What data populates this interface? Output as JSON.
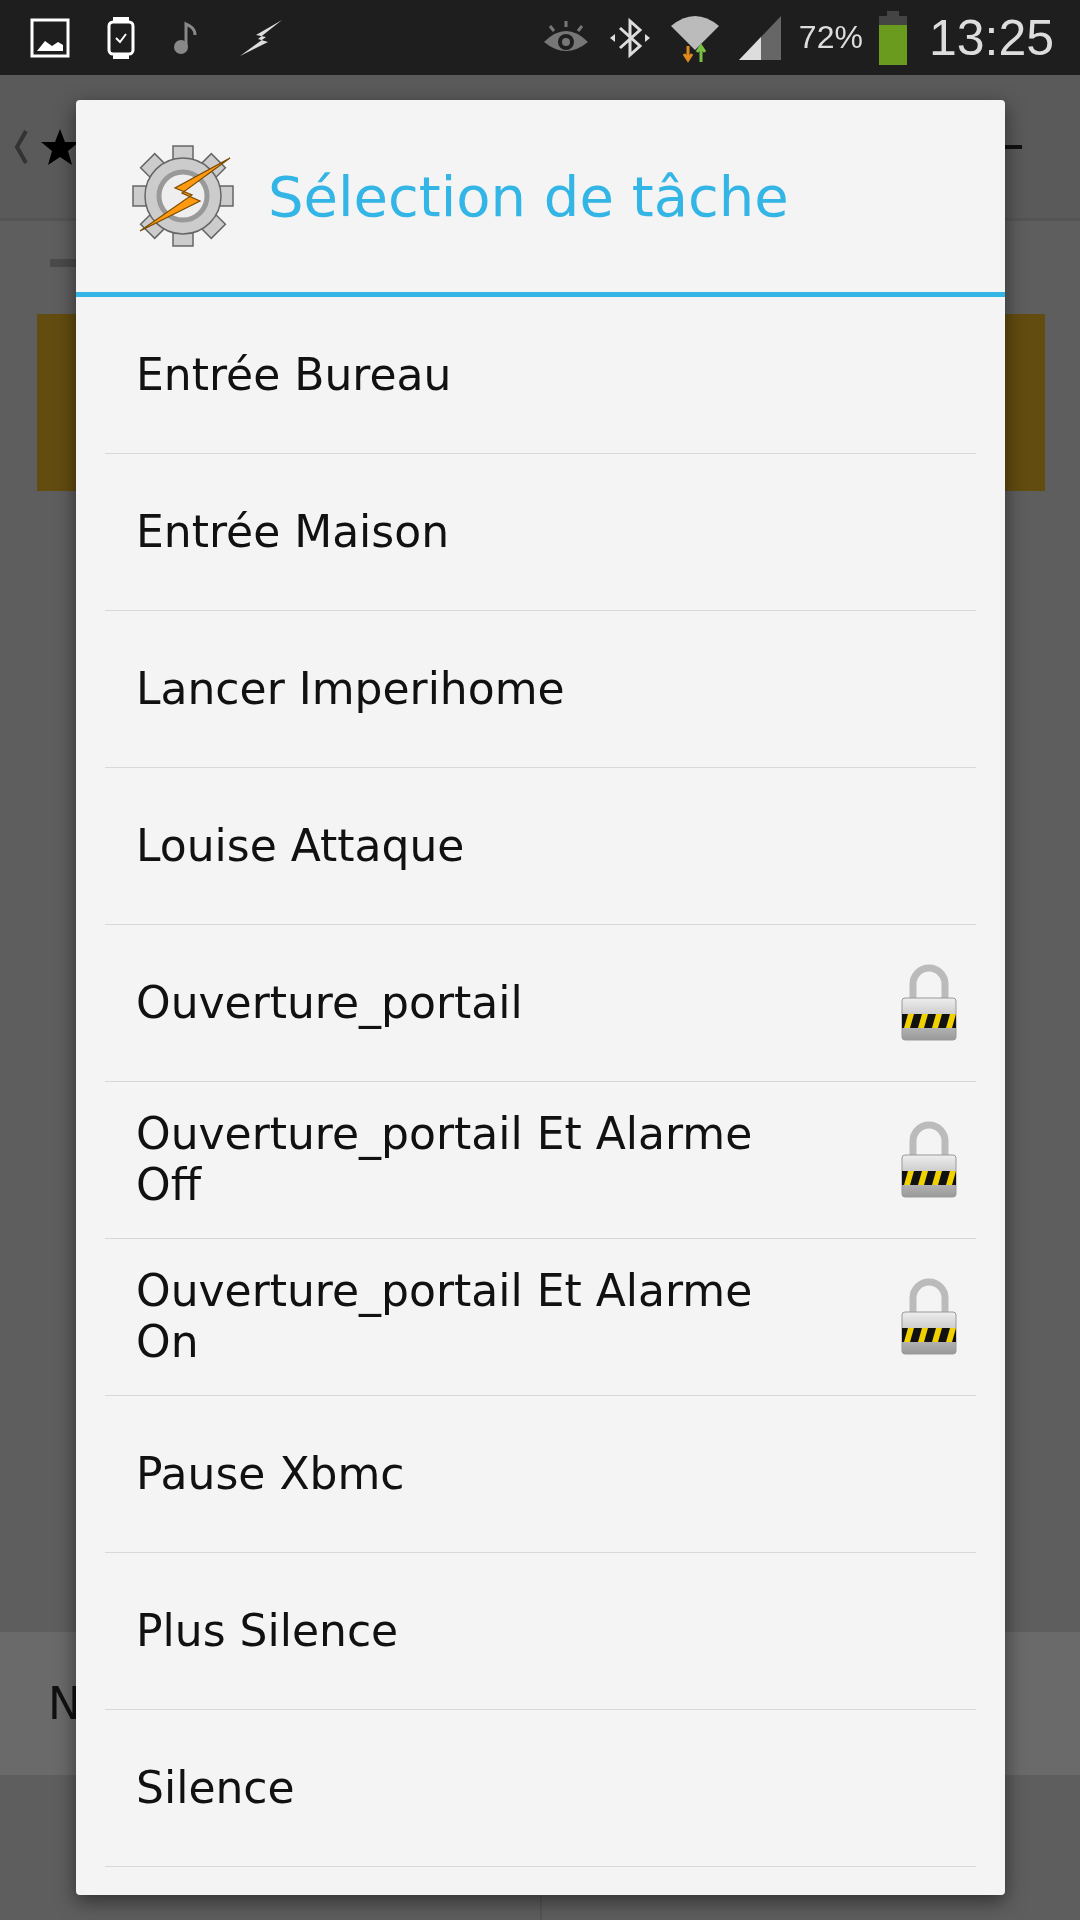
{
  "status_bar": {
    "battery": "72%",
    "time": "13:25"
  },
  "background": {
    "bottom_bar_text": "N"
  },
  "dialog": {
    "title": "Sélection de tâche",
    "items": [
      {
        "label": "Entrée Bureau",
        "locked": false
      },
      {
        "label": "Entrée Maison",
        "locked": false
      },
      {
        "label": "Lancer Imperihome",
        "locked": false
      },
      {
        "label": "Louise Attaque",
        "locked": false
      },
      {
        "label": "Ouverture_portail",
        "locked": true
      },
      {
        "label": "Ouverture_portail Et Alarme Off",
        "locked": true
      },
      {
        "label": "Ouverture_portail Et Alarme On",
        "locked": true
      },
      {
        "label": "Pause Xbmc",
        "locked": false
      },
      {
        "label": "Plus Silence",
        "locked": false
      },
      {
        "label": "Silence",
        "locked": false
      }
    ]
  }
}
